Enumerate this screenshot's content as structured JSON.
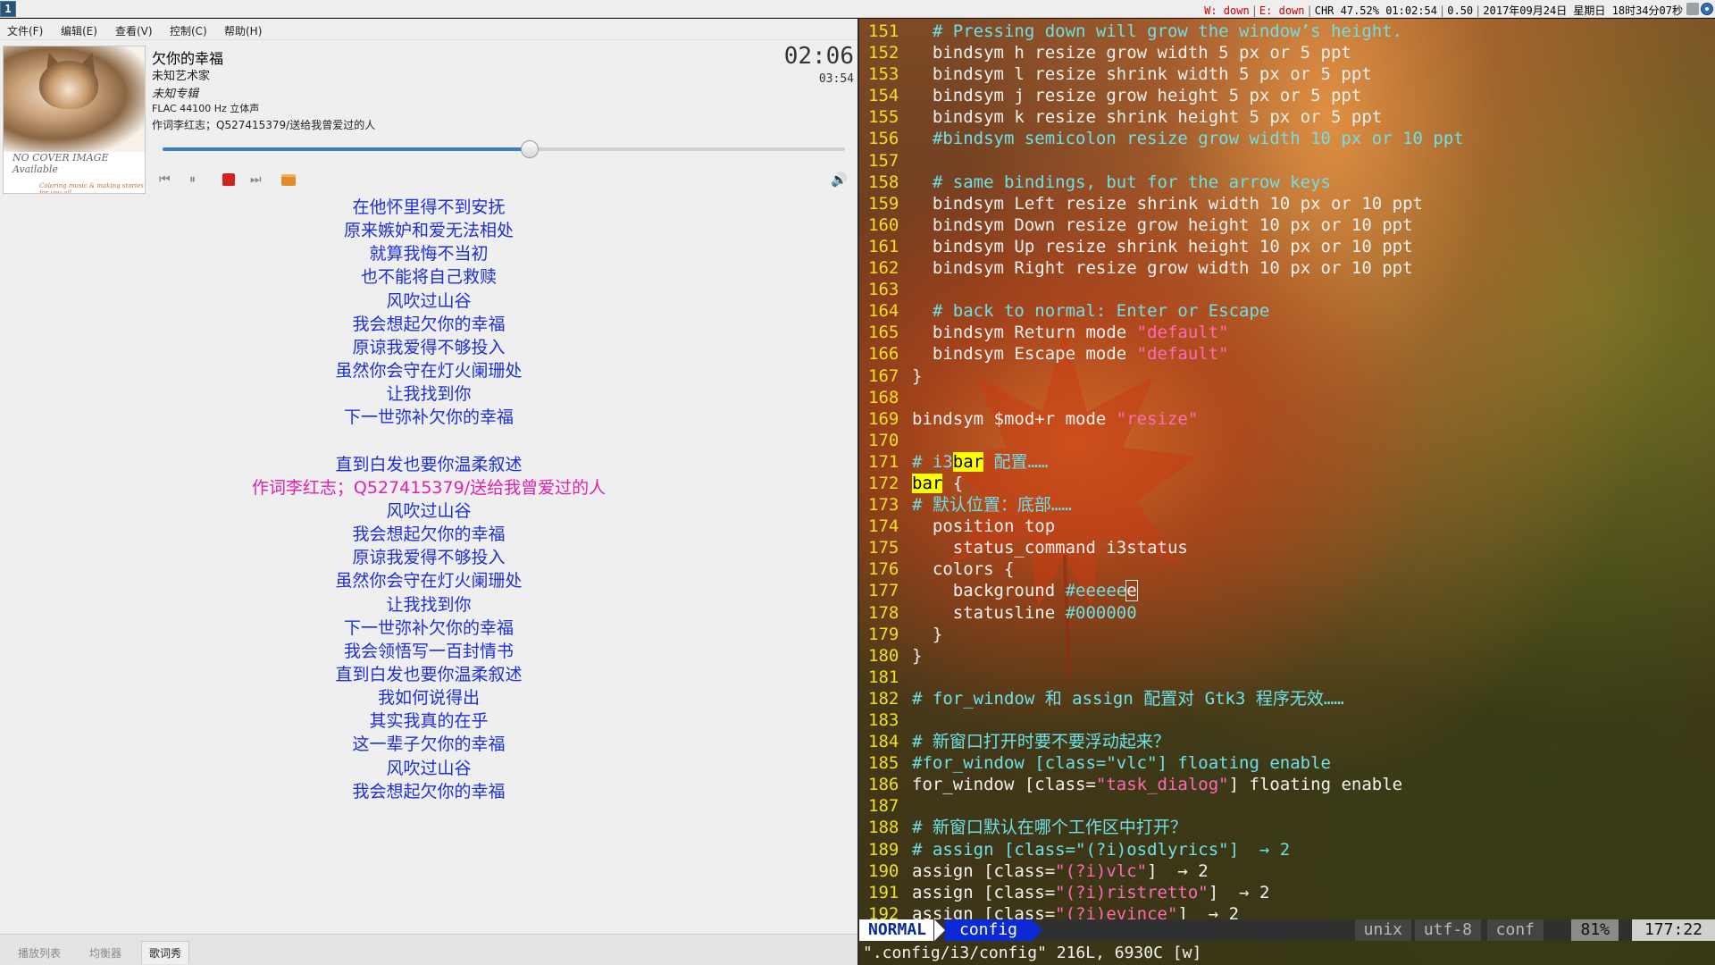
{
  "i3bar": {
    "workspace": "1",
    "status": {
      "wireless": "W: down",
      "ethernet": "E: down",
      "battery": "CHR 47.52% 01:02:54",
      "load": "0.50",
      "datetime": "2017年09月24日 星期日 18时34分07秒"
    }
  },
  "player": {
    "menu": [
      "文件(F)",
      "编辑(E)",
      "查看(V)",
      "控制(C)",
      "帮助(H)"
    ],
    "cover": {
      "line1": "NO COVER IMAGE",
      "line2": "Available",
      "tagline": "Coloring music & making stories for you all"
    },
    "track": {
      "title": "欠你的幸福",
      "artist": "未知艺术家",
      "album": "未知专辑",
      "format": "FLAC 44100 Hz 立体声",
      "comment": "作词李红志；Q527415379/送给我曾爱过的人"
    },
    "time": {
      "elapsed": "02:06",
      "total": "03:54"
    },
    "progress": 0.538,
    "controls": {
      "prev": "⏮",
      "pause": "⏸",
      "next": "⏭",
      "volume": "🔊"
    },
    "lyrics": [
      "在他怀里得不到安抚",
      "原来嫉妒和爱无法相处",
      "就算我悔不当初",
      "也不能将自己救赎",
      "风吹过山谷",
      "我会想起欠你的幸福",
      "原谅我爱得不够投入",
      "虽然你会守在灯火阑珊处",
      "让我找到你",
      "下一世弥补欠你的幸福",
      "",
      "直到白发也要你温柔叙述",
      "作词李红志；Q527415379/送给我曾爱过的人",
      "风吹过山谷",
      "我会想起欠你的幸福",
      "原谅我爱得不够投入",
      "虽然你会守在灯火阑珊处",
      "让我找到你",
      "下一世弥补欠你的幸福",
      "我会领悟写一百封情书",
      "直到白发也要你温柔叙述",
      "我如何说得出",
      "其实我真的在乎",
      "这一辈子欠你的幸福",
      "风吹过山谷",
      "我会想起欠你的幸福"
    ],
    "current_lyric_index": 12,
    "tabs": [
      "播放列表",
      "均衡器",
      "歌词秀"
    ],
    "active_tab": 2
  },
  "editor": {
    "lines": [
      {
        "n": "151",
        "t": [
          {
            "s": "  # Pressing down will grow the window’s height.",
            "c": "comment"
          }
        ]
      },
      {
        "n": "152",
        "t": [
          {
            "s": "  bindsym h resize grow width 5 px or 5 ppt"
          }
        ]
      },
      {
        "n": "153",
        "t": [
          {
            "s": "  bindsym l resize shrink width 5 px or 5 ppt"
          }
        ]
      },
      {
        "n": "154",
        "t": [
          {
            "s": "  bindsym j resize grow height 5 px or 5 ppt"
          }
        ]
      },
      {
        "n": "155",
        "t": [
          {
            "s": "  bindsym k resize shrink height 5 px or 5 ppt"
          }
        ]
      },
      {
        "n": "156",
        "t": [
          {
            "s": "  #bindsym semicolon resize grow width 10 px or 10 ppt",
            "c": "comment"
          }
        ]
      },
      {
        "n": "157",
        "t": [
          {
            "s": ""
          }
        ]
      },
      {
        "n": "158",
        "t": [
          {
            "s": "  # same bindings, but for the arrow keys",
            "c": "comment"
          }
        ]
      },
      {
        "n": "159",
        "t": [
          {
            "s": "  bindsym Left resize shrink width 10 px or 10 ppt"
          }
        ]
      },
      {
        "n": "160",
        "t": [
          {
            "s": "  bindsym Down resize grow height 10 px or 10 ppt"
          }
        ]
      },
      {
        "n": "161",
        "t": [
          {
            "s": "  bindsym Up resize shrink height 10 px or 10 ppt"
          }
        ]
      },
      {
        "n": "162",
        "t": [
          {
            "s": "  bindsym Right resize grow width 10 px or 10 ppt"
          }
        ]
      },
      {
        "n": "163",
        "t": [
          {
            "s": ""
          }
        ]
      },
      {
        "n": "164",
        "t": [
          {
            "s": "  # back to normal: Enter or Escape",
            "c": "comment"
          }
        ]
      },
      {
        "n": "165",
        "t": [
          {
            "s": "  bindsym Return mode "
          },
          {
            "s": "\"default\"",
            "c": "string"
          }
        ]
      },
      {
        "n": "166",
        "t": [
          {
            "s": "  bindsym Escape mode "
          },
          {
            "s": "\"default\"",
            "c": "string"
          }
        ]
      },
      {
        "n": "167",
        "t": [
          {
            "s": "}"
          }
        ]
      },
      {
        "n": "168",
        "t": [
          {
            "s": ""
          }
        ]
      },
      {
        "n": "169",
        "t": [
          {
            "s": "bindsym $mod+r mode "
          },
          {
            "s": "\"resize\"",
            "c": "string"
          }
        ]
      },
      {
        "n": "170",
        "t": [
          {
            "s": ""
          }
        ]
      },
      {
        "n": "171",
        "t": [
          {
            "s": "# i3",
            "c": "comment"
          },
          {
            "s": "bar",
            "c": "hl"
          },
          {
            "s": " 配置……",
            "c": "comment"
          }
        ]
      },
      {
        "n": "172",
        "t": [
          {
            "s": "bar",
            "c": "hl"
          },
          {
            "s": " {"
          }
        ]
      },
      {
        "n": "173",
        "t": [
          {
            "s": "# 默认位置：底部……",
            "c": "comment"
          }
        ]
      },
      {
        "n": "174",
        "t": [
          {
            "s": "  position top"
          }
        ]
      },
      {
        "n": "175",
        "t": [
          {
            "s": "    status_command i3status"
          }
        ]
      },
      {
        "n": "176",
        "t": [
          {
            "s": "  colors {"
          }
        ]
      },
      {
        "n": "177",
        "t": [
          {
            "s": "    background "
          },
          {
            "s": "#eeeee",
            "c": "comment"
          },
          {
            "s": "e",
            "c": "cursor"
          }
        ]
      },
      {
        "n": "178",
        "t": [
          {
            "s": "    statusline "
          },
          {
            "s": "#000000",
            "c": "comment"
          }
        ]
      },
      {
        "n": "179",
        "t": [
          {
            "s": "  }"
          }
        ]
      },
      {
        "n": "180",
        "t": [
          {
            "s": "}"
          }
        ]
      },
      {
        "n": "181",
        "t": [
          {
            "s": ""
          }
        ]
      },
      {
        "n": "182",
        "t": [
          {
            "s": "# for_window 和 assign 配置对 Gtk3 程序无效……",
            "c": "comment"
          }
        ]
      },
      {
        "n": "183",
        "t": [
          {
            "s": ""
          }
        ]
      },
      {
        "n": "184",
        "t": [
          {
            "s": "# 新窗口打开时要不要浮动起来？",
            "c": "comment"
          }
        ]
      },
      {
        "n": "185",
        "t": [
          {
            "s": "#for_window [class=\"vlc\"] floating enable",
            "c": "comment"
          }
        ]
      },
      {
        "n": "186",
        "t": [
          {
            "s": "for_window [class="
          },
          {
            "s": "\"task_dialog\"",
            "c": "string"
          },
          {
            "s": "] floating enable"
          }
        ]
      },
      {
        "n": "187",
        "t": [
          {
            "s": ""
          }
        ]
      },
      {
        "n": "188",
        "t": [
          {
            "s": "# 新窗口默认在哪个工作区中打开？",
            "c": "comment"
          }
        ]
      },
      {
        "n": "189",
        "t": [
          {
            "s": "# assign [class=\"(?i)osdlyrics\"]  → 2",
            "c": "comment"
          }
        ]
      },
      {
        "n": "190",
        "t": [
          {
            "s": "assign [class="
          },
          {
            "s": "\"(?i)vlc\"",
            "c": "string"
          },
          {
            "s": "]  → 2"
          }
        ]
      },
      {
        "n": "191",
        "t": [
          {
            "s": "assign [class="
          },
          {
            "s": "\"(?i)ristretto\"",
            "c": "string"
          },
          {
            "s": "]  → 2"
          }
        ]
      },
      {
        "n": "192",
        "t": [
          {
            "s": "assign [class="
          },
          {
            "s": "\"(?i)evince\"",
            "c": "string"
          },
          {
            "s": "]  → 2"
          }
        ]
      }
    ],
    "statusline": {
      "mode": "NORMAL",
      "filename": "config",
      "fileformat": "unix",
      "encoding": "utf-8",
      "filetype": "conf",
      "percent": "81%",
      "position": "177:22"
    },
    "cmdline": "\".config/i3/config\" 216L, 6930C [w]"
  },
  "colors": {
    "lyric": "#1e2fd8",
    "lyric_current": "#e020b0",
    "line_number": "#f0e020",
    "comment": "#6ee0e8",
    "string": "#ff6ab8",
    "search_highlight": "#ffff00",
    "mode_bg": "#0a2ad8"
  }
}
